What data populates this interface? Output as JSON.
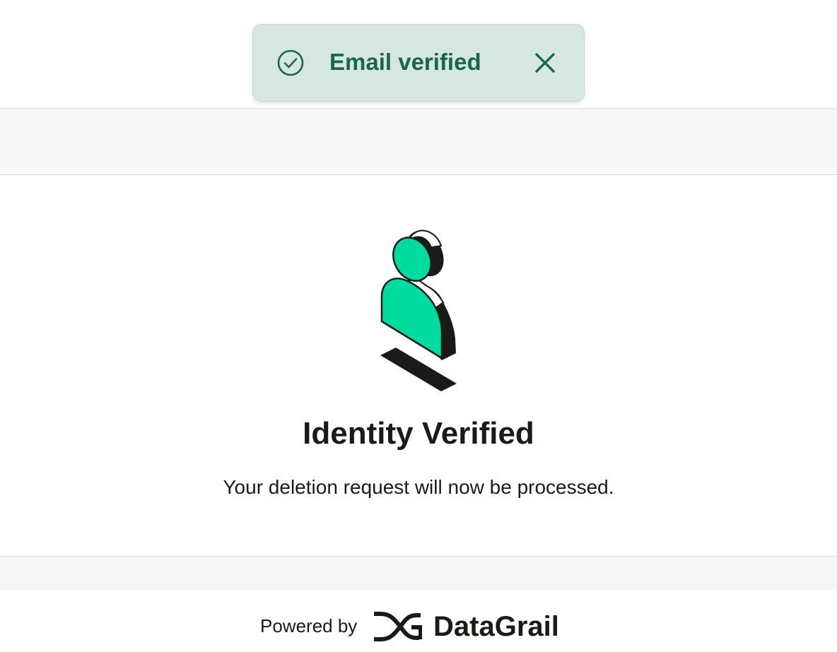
{
  "toast": {
    "message": "Email verified",
    "icon": "check-circle-icon",
    "close_icon": "close-icon",
    "accent_color": "#17664f",
    "background_color": "#d6e7e1"
  },
  "main": {
    "illustration": "person-verified-illustration",
    "title": "Identity Verified",
    "subtitle": "Your deletion request will now be processed."
  },
  "footer": {
    "powered_by_label": "Powered by",
    "brand_name": "DataGrail",
    "brand_icon": "datagrail-logo-icon"
  },
  "colors": {
    "illustration_green": "#00dba0",
    "text": "#1a1a17",
    "band_gray": "#f6f7f6"
  }
}
